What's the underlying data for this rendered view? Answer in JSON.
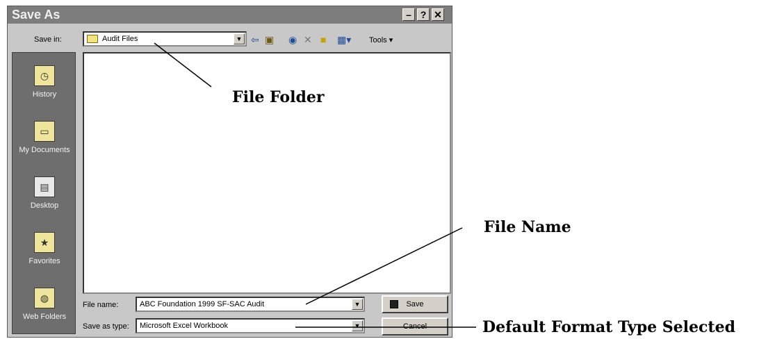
{
  "dialog": {
    "title": "Save As",
    "title_buttons": {
      "help": "?",
      "close": "✕",
      "minimize": "–"
    }
  },
  "toolbar": {
    "save_in_label": "Save in:",
    "save_in_value": "Audit Files",
    "tools_label": "Tools ▾",
    "icons": [
      "back-icon",
      "up-folder-icon",
      "search-web-icon",
      "delete-icon",
      "new-folder-icon",
      "views-icon"
    ]
  },
  "places": [
    {
      "label": "History",
      "icon": "history-icon"
    },
    {
      "label": "My Documents",
      "icon": "my-documents-icon"
    },
    {
      "label": "Desktop",
      "icon": "desktop-icon"
    },
    {
      "label": "Favorites",
      "icon": "favorites-icon"
    },
    {
      "label": "Web Folders",
      "icon": "web-folders-icon"
    }
  ],
  "form": {
    "file_name_label": "File name:",
    "file_name_value": "ABC Foundation 1999 SF-SAC Audit",
    "save_as_type_label": "Save as type:",
    "save_as_type_value": "Microsoft Excel Workbook"
  },
  "buttons": {
    "save": "Save",
    "cancel": "Cancel"
  },
  "annotations": {
    "file_folder": "File Folder",
    "file_name": "File Name",
    "default_format": "Default Format Type Selected"
  }
}
